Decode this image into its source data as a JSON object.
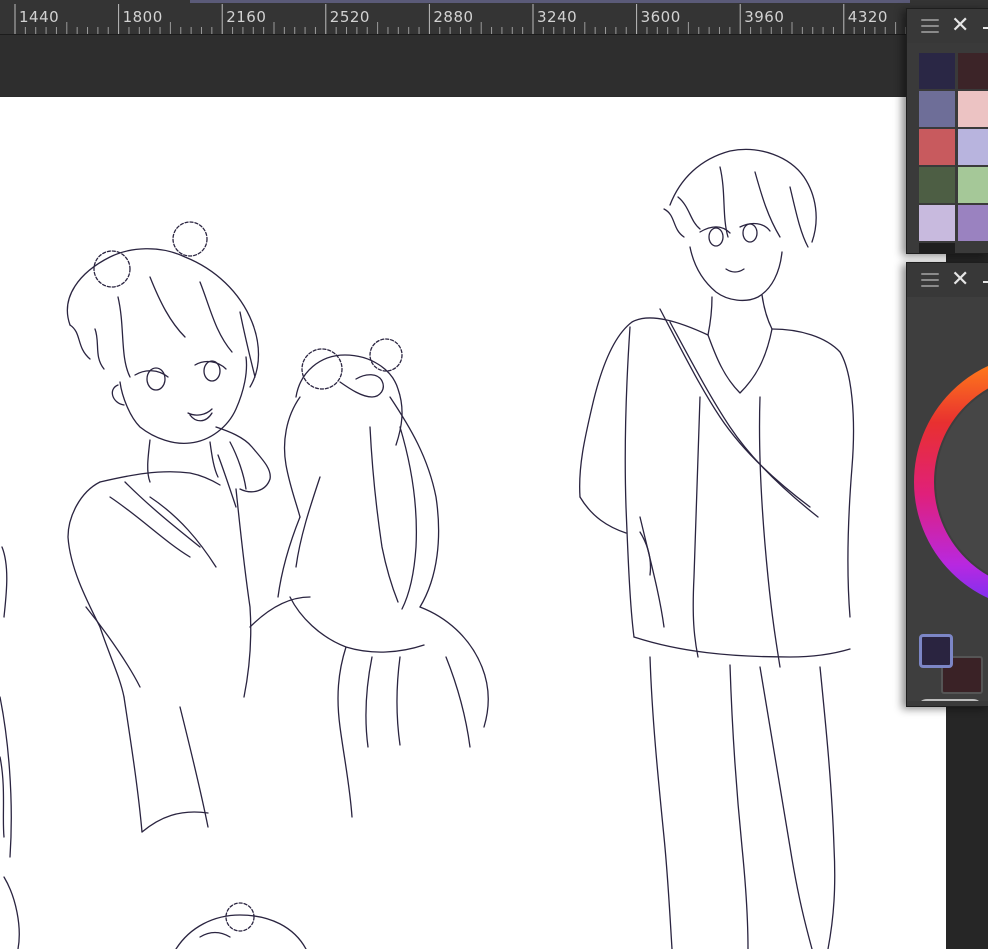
{
  "ruler": {
    "labels": [
      "1440",
      "1800",
      "2160",
      "2520",
      "2880",
      "3240",
      "3600",
      "3960",
      "4320"
    ]
  },
  "color_set_panel": {
    "menu_icon": "hamburger-icon",
    "close_icon": "close-icon",
    "swatches": [
      [
        "#2a2745",
        "#3c2428"
      ],
      [
        "#6e6e98",
        "#ecc3c3"
      ],
      [
        "#c85a5e",
        "#b8b4de"
      ],
      [
        "#4d5e44",
        "#a5c898"
      ],
      [
        "#c8bade",
        "#9a82c0"
      ]
    ]
  },
  "color_wheel_panel": {
    "menu_icon": "hamburger-icon",
    "close_icon": "close-icon",
    "main_color": "#2a2440",
    "sub_color": "#3a2226"
  },
  "canvas": {
    "background": "#ffffff",
    "line_color": "#2a2440"
  }
}
